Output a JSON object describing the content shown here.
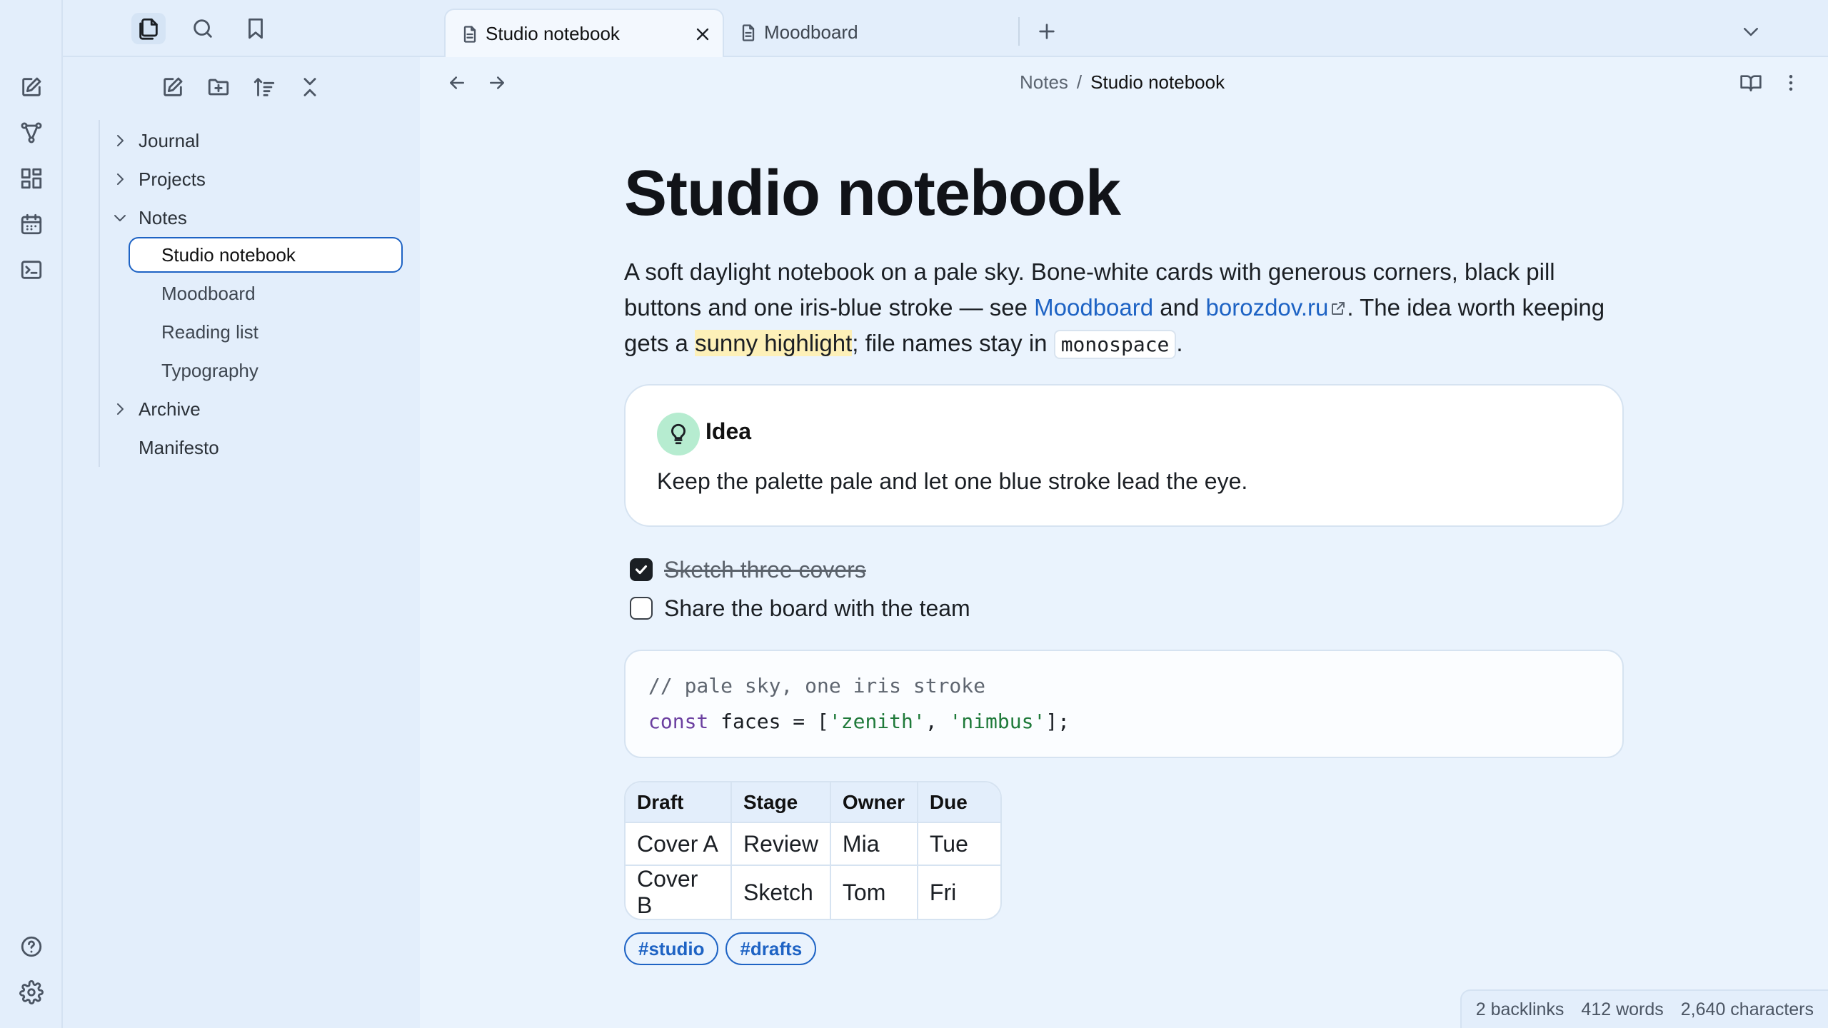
{
  "tabs": [
    {
      "label": "Studio notebook",
      "active": true
    },
    {
      "label": "Moodboard",
      "active": false
    }
  ],
  "breadcrumb": {
    "parent": "Notes",
    "separator": "/",
    "current": "Studio notebook"
  },
  "sidebar": {
    "tree": [
      {
        "label": "Journal",
        "type": "folder",
        "expanded": false
      },
      {
        "label": "Projects",
        "type": "folder",
        "expanded": false
      },
      {
        "label": "Notes",
        "type": "folder",
        "expanded": true,
        "children": [
          "Studio notebook",
          "Moodboard",
          "Reading list",
          "Typography"
        ]
      },
      {
        "label": "Archive",
        "type": "folder",
        "expanded": false
      },
      {
        "label": "Manifesto",
        "type": "file"
      }
    ]
  },
  "note": {
    "title": "Studio notebook",
    "intro": {
      "p1": "A soft daylight notebook on a pale sky. Bone-white cards with generous corners, black pill buttons and one iris-blue stroke — see ",
      "link1": "Moodboard",
      "p2": " and ",
      "link2": "borozdov.ru",
      "p3": ". The idea worth keeping gets a ",
      "highlight": "sunny highlight",
      "p4": "; file names stay in ",
      "code": "monospace",
      "p5": "."
    },
    "callout": {
      "title": "Idea",
      "body": "Keep the palette pale and let one blue stroke lead the eye."
    },
    "tasks": [
      {
        "text": "Sketch three covers",
        "done": true
      },
      {
        "text": "Share the board with the team",
        "done": false
      }
    ],
    "code": {
      "line1": "// pale sky, one iris stroke",
      "kw": "const",
      "rest_a": " faces = [",
      "str1": "'zenith'",
      "comma": ", ",
      "str2": "'nimbus'",
      "rest_b": "];"
    },
    "table": {
      "headers": [
        "Draft",
        "Stage",
        "Owner",
        "Due"
      ],
      "rows": [
        [
          "Cover A",
          "Review",
          "Mia",
          "Tue"
        ],
        [
          "Cover B",
          "Sketch",
          "Tom",
          "Fri"
        ]
      ]
    },
    "tags": [
      "#studio",
      "#drafts"
    ]
  },
  "status": {
    "backlinks": "2 backlinks",
    "words": "412 words",
    "characters": "2,640 characters"
  },
  "icons": {
    "ribbon": [
      "compose-icon",
      "graph-icon",
      "dashboard-icon",
      "calendar-icon",
      "terminal-icon",
      "help-icon",
      "settings-icon"
    ],
    "sidebar_tabs": [
      "files-icon",
      "search-icon",
      "bookmark-icon"
    ],
    "sidebar_actions": [
      "new-note-icon",
      "new-folder-icon",
      "sort-icon",
      "collapse-all-icon"
    ]
  },
  "colors": {
    "accent": "#1e63c4",
    "background": "#eaf3fd",
    "highlight": "#fdf0b8",
    "callout_icon_bg": "#b6ecd0"
  }
}
